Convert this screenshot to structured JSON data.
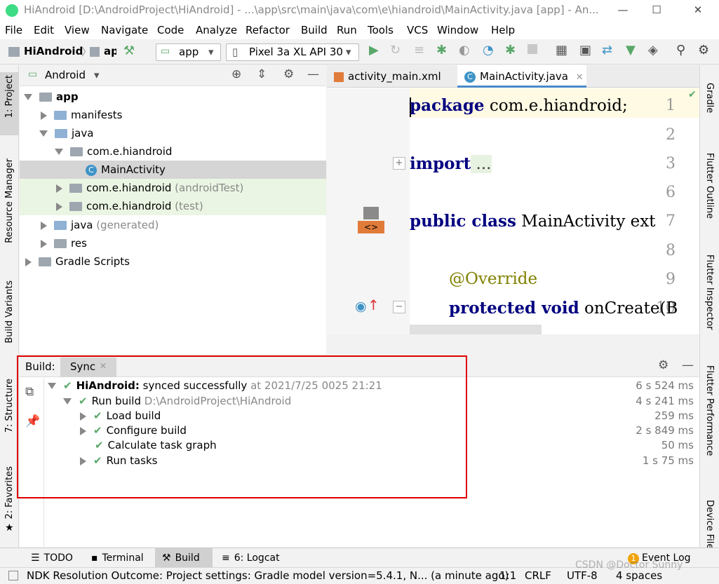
{
  "window": {
    "title": "HiAndroid [D:\\AndroidProject\\HiAndroid] - ...\\app\\src\\main\\java\\com\\e\\hiandroid\\MainActivity.java [app] - An...",
    "minimize": "—",
    "maximize": "☐",
    "close": "✕"
  },
  "menu": [
    "File",
    "Edit",
    "View",
    "Navigate",
    "Code",
    "Analyze",
    "Refactor",
    "Build",
    "Run",
    "Tools",
    "VCS",
    "Window",
    "Help"
  ],
  "toolbar": {
    "project_crumb": "HiAndroid",
    "module_crumb": "ap",
    "run_config": "app",
    "device": "Pixel 3a XL API 30"
  },
  "left_stripe": {
    "project": "1: Project",
    "resource_manager": "Resource Manager",
    "build_variants": "Build Variants",
    "structure": "7: Structure",
    "favorites": "2: Favorites"
  },
  "right_stripe": {
    "gradle": "Gradle",
    "flutter_outline": "Flutter Outline",
    "flutter_inspector": "Flutter Inspector",
    "flutter_performance": "Flutter Performance",
    "device_file": "Device File"
  },
  "project": {
    "view_mode": "Android",
    "tree": [
      {
        "label": "app",
        "suffix": ""
      },
      {
        "label": "manifests",
        "suffix": ""
      },
      {
        "label": "java",
        "suffix": ""
      },
      {
        "label": "com.e.hiandroid",
        "suffix": ""
      },
      {
        "label": "MainActivity",
        "suffix": ""
      },
      {
        "label": "com.e.hiandroid",
        "suffix": " (androidTest)"
      },
      {
        "label": "com.e.hiandroid",
        "suffix": " (test)"
      },
      {
        "label": "java",
        "suffix": " (generated)"
      },
      {
        "label": "res",
        "suffix": ""
      },
      {
        "label": "Gradle Scripts",
        "suffix": ""
      }
    ]
  },
  "editor": {
    "tabs": [
      {
        "label": "activity_main.xml"
      },
      {
        "label": "MainActivity.java"
      }
    ],
    "lines": [
      {
        "num": "1",
        "kw": "package",
        "text": " com.e.hiandroid;"
      },
      {
        "num": "2",
        "kw": "",
        "text": ""
      },
      {
        "num": "3",
        "kw": "import",
        "text": " ..."
      },
      {
        "num": "6",
        "kw": "",
        "text": ""
      },
      {
        "num": "7",
        "kw": "public class",
        "text": " MainActivity ext"
      },
      {
        "num": "8",
        "kw": "",
        "text": ""
      },
      {
        "num": "9",
        "kw": "",
        "text": "@Override"
      },
      {
        "num": "10",
        "kw": "protected void",
        "text": " onCreate(B"
      }
    ]
  },
  "build": {
    "label": "Build:",
    "tab": "Sync",
    "rows": [
      {
        "title": "HiAndroid:",
        "text": " synced successfully",
        "extra": " at 2021/7/25 0025 21:21",
        "time": "6 s 524 ms"
      },
      {
        "title": "",
        "text": "Run build",
        "extra": " D:\\AndroidProject\\HiAndroid",
        "time": "4 s 241 ms"
      },
      {
        "title": "",
        "text": "Load build",
        "extra": "",
        "time": "259 ms"
      },
      {
        "title": "",
        "text": "Configure build",
        "extra": "",
        "time": "2 s 849 ms"
      },
      {
        "title": "",
        "text": "Calculate task graph",
        "extra": "",
        "time": "50 ms"
      },
      {
        "title": "",
        "text": "Run tasks",
        "extra": "",
        "time": "1 s 75 ms"
      }
    ]
  },
  "bottom_tabs": {
    "todo": "TODO",
    "terminal": "Terminal",
    "build": "Build",
    "logcat": "6: Logcat",
    "event_log": "Event Log",
    "event_count": "1"
  },
  "status": {
    "message": "NDK Resolution Outcome: Project settings: Gradle model version=5.4.1, N... (a minute ago)",
    "position": "1:1",
    "line_sep": "CRLF",
    "encoding": "UTF-8",
    "indent": "4 spaces",
    "watermark": "CSDN @Doctor Sunny"
  }
}
